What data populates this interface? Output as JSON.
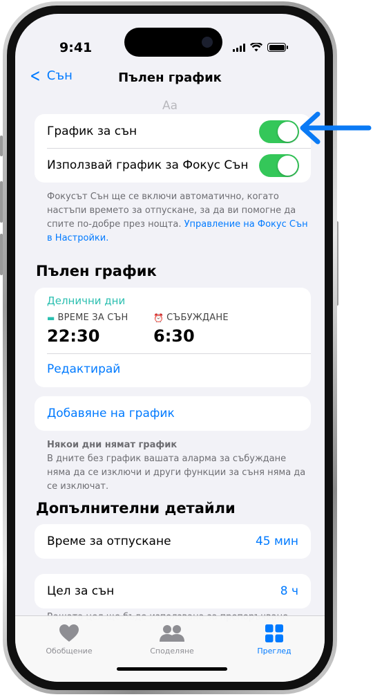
{
  "status": {
    "time": "9:41"
  },
  "nav": {
    "back_label": "Сън",
    "title": "Пълен график",
    "faded_text": "Аа"
  },
  "toggles": [
    {
      "label": "График за сън",
      "on": true
    },
    {
      "label": "Използвай график за Фокус Сън",
      "on": true
    }
  ],
  "focus_note": {
    "text": "Фокусът Сън ще се включи автоматично, когато настъпи времето за отпускане, за да ви помогне да спите по-добре през нощта.",
    "link": "Управление на Фокус Сън в Настройки."
  },
  "full_schedule": {
    "heading": "Пълен график",
    "days_label": "Делнични дни",
    "bedtime_label": "ВРЕМЕ ЗА СЪН",
    "bedtime_value": "22:30",
    "wake_label": "СЪБУЖДАНЕ",
    "wake_value": "6:30",
    "edit_label": "Редактирай",
    "add_label": "Добавяне на график"
  },
  "no_schedule_note": {
    "title": "Някои дни нямат график",
    "text": "В дните без график вашата аларма за събуждане няма да се изключи и други функции за съня няма да се изключат."
  },
  "details": {
    "heading": "Допълнителни детайли",
    "wind_down_label": "Време за отпускане",
    "wind_down_value": "45 мин",
    "goal_label": "Цел за сън",
    "goal_value": "8 ч",
    "goal_note": "Вашата цел ще бъде използвана за препоръчване"
  },
  "tabbar": {
    "tabs": [
      {
        "label": "Обобщение",
        "icon": "heart-icon",
        "active": false
      },
      {
        "label": "Споделяне",
        "icon": "people-icon",
        "active": false
      },
      {
        "label": "Преглед",
        "icon": "grid-icon",
        "active": true
      }
    ]
  },
  "colors": {
    "accent": "#007aff",
    "toggle_on": "#34c759",
    "sleep_teal": "#2bbfb0",
    "callout_arrow": "#0a7af5"
  }
}
